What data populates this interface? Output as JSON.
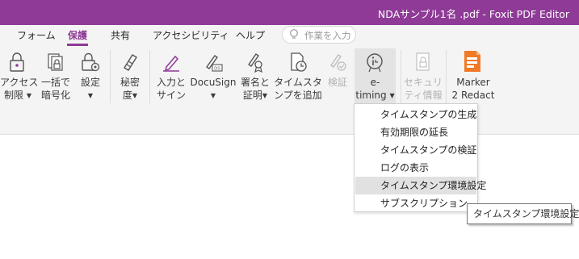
{
  "window": {
    "title": "NDAサンプル1名 .pdf - Foxit PDF Editor"
  },
  "menubar": {
    "items": [
      "フォーム",
      "保護",
      "共有",
      "アクセシビリティ",
      "ヘルプ"
    ],
    "active": "保護"
  },
  "search": {
    "placeholder": "作業を入力"
  },
  "ribbon": {
    "buttons": [
      {
        "line1": "アクセス",
        "line2": "制限",
        "caret": true,
        "icon": "lock-icon"
      },
      {
        "line1": "一括で",
        "line2": "暗号化",
        "caret": false,
        "icon": "batch-encrypt-icon"
      },
      {
        "line1": "設定",
        "line2": "",
        "caret": true,
        "icon": "settings-lock-icon"
      },
      {
        "line1": "秘密",
        "line2": "度",
        "caret": true,
        "icon": "confidential-icon"
      },
      {
        "line1": "入力と",
        "line2": "サイン",
        "caret": false,
        "icon": "pen-sign-icon"
      },
      {
        "line1": "DocuSign",
        "line2": "",
        "caret": true,
        "icon": "docusign-icon"
      },
      {
        "line1": "署名と",
        "line2": "証明",
        "caret": true,
        "icon": "certify-icon"
      },
      {
        "line1": "タイムスタ",
        "line2": "ンプを追加",
        "caret": false,
        "icon": "timestamp-doc-icon"
      },
      {
        "line1": "検証",
        "line2": "",
        "caret": false,
        "icon": "validate-icon",
        "disabled": true
      },
      {
        "line1": "e-",
        "line2": "timing",
        "caret": true,
        "icon": "etiming-icon"
      },
      {
        "line1": "セキュリ",
        "line2": "ティ情報",
        "caret": false,
        "icon": "security-info-icon",
        "disabled": true
      },
      {
        "line1": "Marker",
        "line2": "2 Redact",
        "caret": false,
        "icon": "marker-redact-icon"
      }
    ]
  },
  "etiming_menu": {
    "items": [
      "タイムスタンプの生成",
      "有効期限の延長",
      "タイムスタンプの検証",
      "ログの表示",
      "タイムスタンプ環境設定",
      "サブスクリプション"
    ],
    "selected": "タイムスタンプ環境設定"
  },
  "tooltip": {
    "text": "タイムスタンプ環境設定"
  },
  "colors": {
    "accent": "#8e3a96",
    "ribbon_bg": "#f4f4f4",
    "marker_orange": "#f07a27"
  }
}
